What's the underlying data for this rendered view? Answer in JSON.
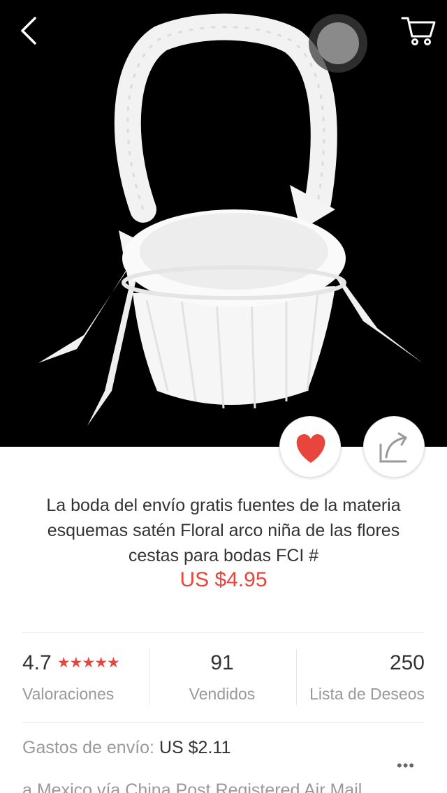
{
  "product": {
    "title": "La boda del envío gratis fuentes de la materia esquemas satén Floral arco niña de las flores cestas para bodas FCI #",
    "price": "US $4.95"
  },
  "stats": {
    "rating": {
      "value": "4.7",
      "stars": "★★★★★",
      "label": "Valoraciones"
    },
    "sold": {
      "value": "91",
      "label": "Vendidos"
    },
    "wishlist": {
      "value": "250",
      "label": "Lista de Deseos"
    }
  },
  "shipping": {
    "label": "Gastos de envío:",
    "value": "US $2.11",
    "method": "a Mexico vía China Post Registered Air Mail",
    "more": "•••"
  },
  "icons": {
    "back": "chevron-left-icon",
    "cart": "cart-icon",
    "wishlist": "heart-icon",
    "share": "share-icon"
  },
  "colors": {
    "accent": "#e8453c",
    "hero_background": "#000000"
  }
}
